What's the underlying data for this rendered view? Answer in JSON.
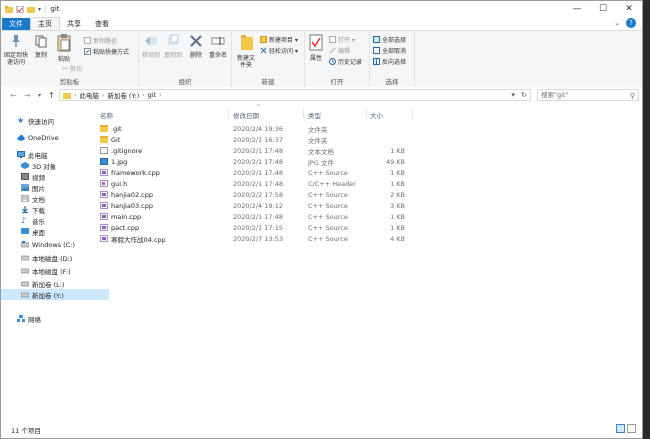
{
  "window": {
    "title": "git",
    "controls": {
      "minimize": "—",
      "maximize": "☐",
      "close": "✕"
    }
  },
  "tabs": [
    "文件",
    "主页",
    "共享",
    "查看"
  ],
  "ribbon": {
    "clipboard": {
      "title": "剪贴板",
      "pin": "固定到快速访问",
      "copy": "复制",
      "paste": "粘贴",
      "copy_path": "复制路径",
      "paste_shortcut": "粘贴快捷方式",
      "cut": "剪切"
    },
    "organize": {
      "title": "组织",
      "move_to": "移动到",
      "copy_to": "复制到",
      "delete": "删除",
      "rename": "重命名"
    },
    "new": {
      "title": "新建",
      "new_folder": "新建文件夹",
      "new_item": "新建项目 ▾",
      "easy_access": "轻松访问 ▾"
    },
    "open": {
      "title": "打开",
      "properties": "属性",
      "open": "打开 ▾",
      "edit": "编辑",
      "history": "历史记录"
    },
    "select": {
      "title": "选择",
      "select_all": "全部选择",
      "select_none": "全部取消",
      "invert": "反向选择"
    }
  },
  "address": {
    "back": "←",
    "forward": "→",
    "recent": "▾",
    "up": "↑",
    "crumbs": [
      "此电脑",
      "新加卷 (Y:)",
      "git"
    ],
    "separator": "›",
    "dropdown": "▾",
    "refresh": "↻",
    "search_placeholder": "搜索\"git\"",
    "search_icon": "⚲"
  },
  "sidebar": [
    {
      "label": "快速访问",
      "icon": "star-icon"
    },
    {
      "label": "OneDrive",
      "icon": "cloud-icon"
    },
    {
      "label": "此电脑",
      "icon": "computer-icon"
    },
    {
      "label": "3D 对象",
      "icon": "cube-icon"
    },
    {
      "label": "视频",
      "icon": "video-icon"
    },
    {
      "label": "图片",
      "icon": "picture-icon"
    },
    {
      "label": "文档",
      "icon": "document-icon"
    },
    {
      "label": "下载",
      "icon": "download-icon"
    },
    {
      "label": "音乐",
      "icon": "music-icon"
    },
    {
      "label": "桌面",
      "icon": "desktop-icon"
    },
    {
      "label": "Windows (C:)",
      "icon": "drive-icon"
    },
    {
      "label": "本地磁盘 (D:)",
      "icon": "drive-icon"
    },
    {
      "label": "本地磁盘 (F:)",
      "icon": "drive-icon"
    },
    {
      "label": "新加卷 (L:)",
      "icon": "drive-icon"
    },
    {
      "label": "新加卷 (Y:)",
      "icon": "drive-icon",
      "selected": true
    },
    {
      "label": "网络",
      "icon": "network-icon"
    }
  ],
  "columns": {
    "name": "名称",
    "date": "修改日期",
    "type": "类型",
    "size": "大小",
    "sort_indicator": "^"
  },
  "files": [
    {
      "name": ".git",
      "date": "2020/2/4 19:36",
      "type": "文件夹",
      "size": "",
      "icon": "folder"
    },
    {
      "name": "Git",
      "date": "2020/2/1 16:37",
      "type": "文件夹",
      "size": "",
      "icon": "folder"
    },
    {
      "name": ".gitignore",
      "date": "2020/2/1 17:48",
      "type": "文本文档",
      "size": "1 KB",
      "icon": "txt"
    },
    {
      "name": "1.jpg",
      "date": "2020/2/1 17:48",
      "type": "JPG 文件",
      "size": "49 KB",
      "icon": "jpg"
    },
    {
      "name": "framework.cpp",
      "date": "2020/2/1 17:48",
      "type": "C++ Source",
      "size": "1 KB",
      "icon": "cpp"
    },
    {
      "name": "gui.h",
      "date": "2020/2/1 17:48",
      "type": "C/C++ Header",
      "size": "1 KB",
      "icon": "h"
    },
    {
      "name": "hanjia02.cpp",
      "date": "2020/2/2 17:58",
      "type": "C++ Source",
      "size": "2 KB",
      "icon": "cpp"
    },
    {
      "name": "hanjia03.cpp",
      "date": "2020/2/4 19:12",
      "type": "C++ Source",
      "size": "3 KB",
      "icon": "cpp"
    },
    {
      "name": "main.cpp",
      "date": "2020/2/1 17:48",
      "type": "C++ Source",
      "size": "1 KB",
      "icon": "cpp"
    },
    {
      "name": "pact.cpp",
      "date": "2020/2/1 17:15",
      "type": "C++ Source",
      "size": "1 KB",
      "icon": "cpp"
    },
    {
      "name": "寒假大作战04.cpp",
      "date": "2020/2/7 13:53",
      "type": "C++ Source",
      "size": "4 KB",
      "icon": "cpp"
    }
  ],
  "status": {
    "count": "11 个项目"
  },
  "colors": {
    "accent": "#1979ca",
    "selection": "#cce8ff",
    "folder": "#f3c94d"
  }
}
